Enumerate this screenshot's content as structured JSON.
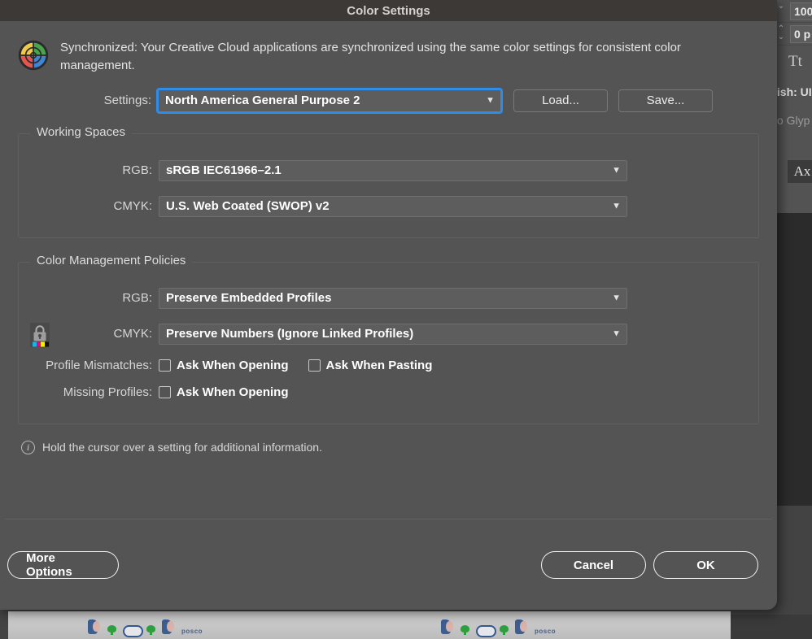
{
  "background": {
    "panel": {
      "tracking_value": "100",
      "kerning_value": "0 p",
      "tt_icon_label": "Tt",
      "language_row": "lish: UI",
      "glyph_row": "to Glyp",
      "ax_button_label": "Ax"
    },
    "document": {
      "watermark_text": "posco"
    }
  },
  "dialog": {
    "title": "Color Settings",
    "intro": {
      "icon": "color-wheel-icon",
      "text": "Synchronized: Your Creative Cloud applications are synchronized using the same color settings for consistent color management."
    },
    "settings_row": {
      "label": "Settings:",
      "value": "North America General Purpose 2",
      "focus_color": "#2f8ce8",
      "load_button": "Load...",
      "save_button": "Save..."
    },
    "working_spaces": {
      "title": "Working Spaces",
      "rows": [
        {
          "label": "RGB:",
          "value": "sRGB IEC61966–2.1"
        },
        {
          "label": "CMYK:",
          "value": "U.S. Web Coated (SWOP) v2"
        }
      ]
    },
    "color_management_policies": {
      "title": "Color Management Policies",
      "rows": [
        {
          "label": "RGB:",
          "value": "Preserve Embedded Profiles"
        },
        {
          "label": "CMYK:",
          "value": "Preserve Numbers (Ignore Linked Profiles)"
        }
      ],
      "profile_mismatches": {
        "label": "Profile Mismatches:",
        "options": [
          {
            "label": "Ask When Opening",
            "checked": false
          },
          {
            "label": "Ask When Pasting",
            "checked": false
          }
        ]
      },
      "missing_profiles": {
        "label": "Missing Profiles:",
        "options": [
          {
            "label": "Ask When Opening",
            "checked": false
          }
        ]
      }
    },
    "hint": {
      "icon": "info-icon",
      "text": "Hold the cursor over a setting for additional information."
    },
    "footer": {
      "more_options": "More Options",
      "cancel": "Cancel",
      "ok": "OK"
    }
  }
}
